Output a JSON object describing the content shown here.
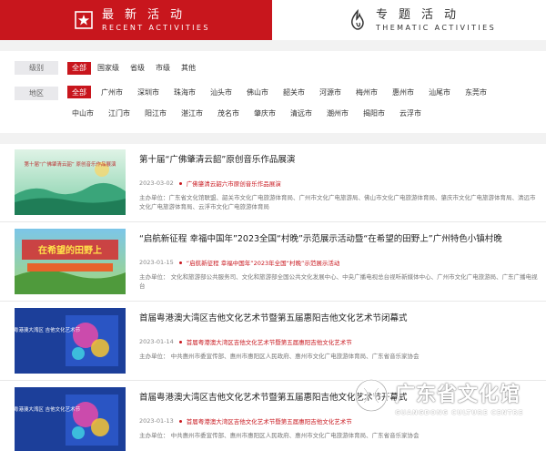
{
  "tabs": {
    "recent": {
      "cn": "最新活动",
      "en": "RECENT ACTIVITIES"
    },
    "thematic": {
      "cn": "专题活动",
      "en": "THEMATIC ACTIVITIES"
    }
  },
  "filters": {
    "level": {
      "label": "级别",
      "options": [
        "全部",
        "国家级",
        "省级",
        "市级",
        "其他"
      ],
      "selected": "全部"
    },
    "region": {
      "label": "地区",
      "options": [
        "全部",
        "广州市",
        "深圳市",
        "珠海市",
        "汕头市",
        "佛山市",
        "韶关市",
        "河源市",
        "梅州市",
        "惠州市",
        "汕尾市",
        "东莞市",
        "中山市",
        "江门市",
        "阳江市",
        "湛江市",
        "茂名市",
        "肇庆市",
        "清远市",
        "潮州市",
        "揭阳市",
        "云浮市"
      ],
      "selected": "全部"
    }
  },
  "news": [
    {
      "title": "第十届“广佛肇清云韶”原创音乐作品展演",
      "date": "2023-03-02",
      "subtitle": "广佛肇清云韶六市原创音乐作品展演",
      "org": "主办单位：广东省文化馆联盟、韶关市文化广电旅游体育局、广州市文化广电旅游局、佛山市文化广电旅游体育局、肇庆市文化广电旅游体育局、清远市文化广电旅游体育局、云浮市文化广电旅游体育局",
      "thumb_text": "第十届“广佛肇清云韶” 原创音乐作品展演"
    },
    {
      "title": "“启航新征程 幸福中国年”2023全国“村晚”示范展示活动暨“在希望的田野上”广州特色小镇村晚",
      "date": "2023-01-15",
      "subtitle": "“启航新征程 幸福中国年”2023年全国“村晚”示范展示活动",
      "org": "主办单位：  文化和旅游部公共服务司、文化和旅游部全国公共文化发展中心、中央广播电视总台视听新媒体中心、广州市文化广电旅游局、广东广播电视台",
      "thumb_text": "在希望的田野上"
    },
    {
      "title": "首届粤港澳大湾区吉他文化艺术节暨第五届惠阳吉他文化艺术节闭幕式",
      "date": "2023-01-14",
      "subtitle": "首届粤港澳大湾区吉他文化艺术节暨第五届惠阳吉他文化艺术节",
      "org": "主办单位：  中共惠州市委宣传部、惠州市惠阳区人民政府、惠州市文化广电旅游体育局、广东省音乐家协会",
      "thumb_text": "首届粤港澳大湾区 吉他文化艺术节"
    },
    {
      "title": "首届粤港澳大湾区吉他文化艺术节暨第五届惠阳吉他文化艺术节开幕式",
      "date": "2023-01-13",
      "subtitle": "首届粤港澳大湾区吉他文化艺术节暨第五届惠阳吉他文化艺术节",
      "org": "主办单位：  中共惠州市委宣传部、惠州市惠阳区人民政府、惠州市文化广电旅游体育局、广东省音乐家协会",
      "thumb_text": "首届粤港澳大湾区 吉他文化艺术节"
    }
  ],
  "watermark": {
    "cn": "广东省文化馆",
    "en": "GUANGDONG CULTURE CENTRE"
  },
  "colors": {
    "accent": "#c8161d"
  }
}
